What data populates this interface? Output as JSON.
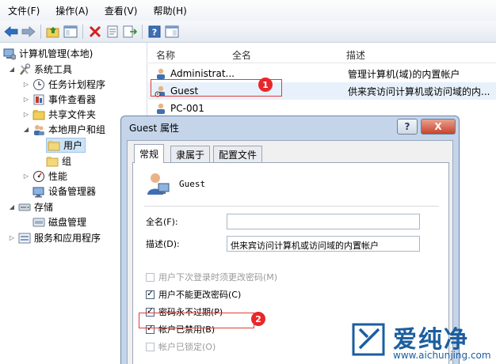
{
  "menu": [
    "文件(F)",
    "操作(A)",
    "查看(V)",
    "帮助(H)"
  ],
  "tree": {
    "root": "计算机管理(本地)",
    "system_tools": "系统工具",
    "task_scheduler": "任务计划程序",
    "event_viewer": "事件查看器",
    "shared_folders": "共享文件夹",
    "local_users": "本地用户和组",
    "users": "用户",
    "groups": "组",
    "performance": "性能",
    "device_manager": "设备管理器",
    "storage": "存储",
    "disk_management": "磁盘管理",
    "services": "服务和应用程序"
  },
  "list": {
    "headers": {
      "name": "名称",
      "fullname": "全名",
      "desc": "描述"
    },
    "rows": [
      {
        "name": "Administrat...",
        "desc": "管理计算机(域)的内置帐户"
      },
      {
        "name": "Guest",
        "desc": "供来宾访问计算机或访问域的内..."
      },
      {
        "name": "PC-001",
        "desc": ""
      }
    ]
  },
  "badges": {
    "one": "1",
    "two": "2"
  },
  "dialog": {
    "title": "Guest 属性",
    "help": "?",
    "close": "X",
    "tabs": [
      "常规",
      "隶属于",
      "配置文件"
    ],
    "username": "Guest",
    "fullname_label": "全名(F):",
    "fullname_value": "",
    "desc_label": "描述(D):",
    "desc_value": "供来宾访问计算机或访问域的内置帐户",
    "options": [
      {
        "label": "用户下次登录时须更改密码(M)",
        "checked": false,
        "disabled": true
      },
      {
        "label": "用户不能更改密码(C)",
        "checked": true,
        "disabled": false
      },
      {
        "label": "密码永不过期(P)",
        "checked": true,
        "disabled": false
      },
      {
        "label": "帐户已禁用(B)",
        "checked": true,
        "disabled": false
      },
      {
        "label": "帐户已锁定(O)",
        "checked": false,
        "disabled": true
      }
    ]
  },
  "watermark": {
    "brand": "爱纯净",
    "url": "www.aichunjing.com"
  },
  "colors": {
    "accent": "#e53a3a",
    "watermark": "#1b5e9f"
  }
}
